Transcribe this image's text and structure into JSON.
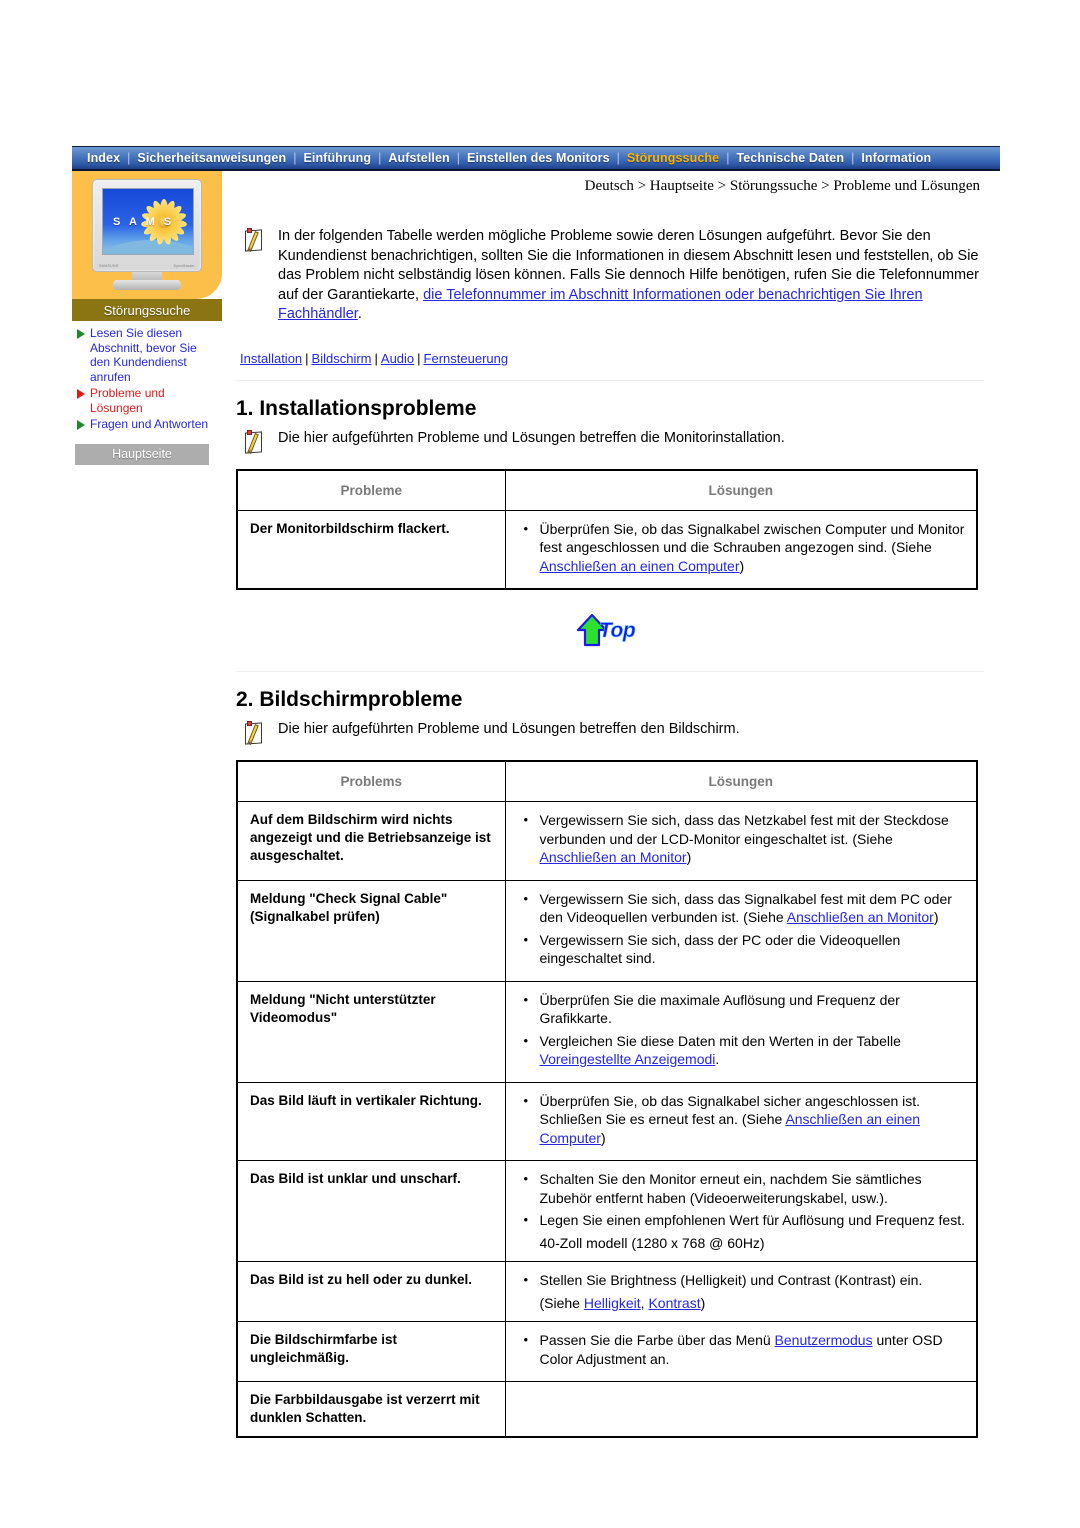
{
  "topnav": {
    "items": [
      {
        "label": "Index",
        "active": false
      },
      {
        "label": "Sicherheitsanweisungen",
        "active": false
      },
      {
        "label": "Einführung",
        "active": false
      },
      {
        "label": "Aufstellen",
        "active": false
      },
      {
        "label": "Einstellen des Monitors",
        "active": false
      },
      {
        "label": "Störungssuche",
        "active": true
      },
      {
        "label": "Technische Daten",
        "active": false
      },
      {
        "label": "Information",
        "active": false
      }
    ],
    "separator": "|",
    "active_color": "#ffb400",
    "text_color": "#ffffff"
  },
  "sidebar": {
    "monitor_screen_text": "S A M S",
    "monitor_brand": "SAMSUNG",
    "monitor_model": "SyncMaster",
    "section_title": "Störungssuche",
    "items": [
      {
        "label": "Lesen Sie diesen Abschnitt, bevor Sie den Kundendienst anrufen",
        "active": false
      },
      {
        "label": "Probleme und Lösungen",
        "active": true
      },
      {
        "label": "Fragen und Antworten",
        "active": false
      }
    ],
    "home_button": "Hauptseite",
    "active_color": "#e01b1b",
    "link_color": "#2727e0",
    "panel_color": "#fbbf4a",
    "title_bar_color": "#8a7512"
  },
  "main": {
    "breadcrumb": "Deutsch > Hauptseite > Störungssuche > Probleme und Lösungen",
    "intro": {
      "text_1": "In der folgenden Tabelle werden mögliche Probleme sowie deren Lösungen aufgeführt. Bevor Sie den Kundendienst benachrichtigen, sollten Sie die Informationen in diesem Abschnitt lesen und feststellen, ob Sie das Problem nicht selbständig lösen können. Falls Sie dennoch Hilfe benötigen, rufen Sie die Telefonnummer auf der Garantiekarte, ",
      "link_1": "die Telefonnummer im Abschnitt Informationen oder benachrichtigen Sie Ihren Fachhändler",
      "text_2": "."
    },
    "sublinks": [
      {
        "label": "Installation"
      },
      {
        "label": "Bildschirm"
      },
      {
        "label": "Audio"
      },
      {
        "label": "Fernsteuerung"
      }
    ],
    "sublink_separator": "|",
    "section1": {
      "heading": "1. Installationsprobleme",
      "note": "Die hier aufgeführten Probleme und Lösungen betreffen die Monitorinstallation.",
      "table": {
        "headers": [
          "Probleme",
          "Lösungen"
        ],
        "rows": [
          {
            "problem": "Der Monitorbildschirm flackert.",
            "solutions": [
              {
                "pre": "Überprüfen Sie, ob das Signalkabel zwischen Computer und Monitor fest angeschlossen und die Schrauben angezogen sind. (Siehe ",
                "link": "Anschließen an einen Computer",
                "post": ")"
              }
            ]
          }
        ]
      }
    },
    "top_button": {
      "label": "Top"
    },
    "section2": {
      "heading": "2. Bildschirmprobleme",
      "note": "Die hier aufgeführten Probleme und Lösungen betreffen den Bildschirm.",
      "table": {
        "headers": [
          "Problems",
          "Lösungen"
        ],
        "rows": [
          {
            "problem": "Auf dem Bildschirm wird nichts angezeigt und die Betriebsanzeige ist ausgeschaltet.",
            "solutions": [
              {
                "pre": "Vergewissern Sie sich, dass das Netzkabel fest mit der Steckdose verbunden und der LCD-Monitor eingeschaltet ist. (Siehe ",
                "link": "Anschließen an Monitor",
                "post": ")"
              }
            ]
          },
          {
            "problem": "Meldung \"Check Signal Cable\" (Signalkabel prüfen)",
            "solutions": [
              {
                "pre": "Vergewissern Sie sich, dass das Signalkabel fest mit dem PC oder den Videoquellen verbunden ist. (Siehe ",
                "link": "Anschließen an Monitor",
                "post": ")"
              },
              {
                "pre": "Vergewissern Sie sich, dass der PC oder die Videoquellen eingeschaltet sind.",
                "link": "",
                "post": ""
              }
            ]
          },
          {
            "problem": "Meldung \"Nicht unterstützter Videomodus\"",
            "solutions": [
              {
                "pre": "Überprüfen Sie die maximale Auflösung und Frequenz der Grafikkarte.",
                "link": "",
                "post": ""
              },
              {
                "pre": "Vergleichen Sie diese Daten mit den Werten in der Tabelle ",
                "link": "Voreingestellte Anzeigemodi",
                "post": "."
              }
            ]
          },
          {
            "problem": "Das Bild läuft in vertikaler Richtung.",
            "solutions": [
              {
                "pre": "Überprüfen Sie, ob das Signalkabel sicher angeschlossen ist. Schließen Sie es erneut fest an. (Siehe ",
                "link": "Anschließen an einen Computer",
                "post": ")"
              }
            ]
          },
          {
            "problem": "Das Bild ist unklar und unscharf.",
            "solutions": [
              {
                "pre": "Schalten Sie den Monitor erneut ein, nachdem Sie sämtliches Zubehör entfernt haben (Videoerweiterungskabel, usw.).",
                "link": "",
                "post": ""
              },
              {
                "pre": "Legen Sie einen empfohlenen Wert für Auflösung und Frequenz fest.",
                "link": "",
                "post": ""
              }
            ],
            "extra_line": "40-Zoll modell (1280 x 768 @ 60Hz)"
          },
          {
            "problem": "Das Bild ist zu hell oder zu dunkel.",
            "solutions": [
              {
                "pre": "Stellen Sie Brightness (Helligkeit) und Contrast (Kontrast) ein.",
                "link": "",
                "post": ""
              }
            ],
            "extra_siehe": {
              "pre": "(Siehe ",
              "link1": "Helligkeit",
              "mid": ", ",
              "link2": "Kontrast",
              "post": ")"
            }
          },
          {
            "problem": "Die Bildschirmfarbe ist ungleichmäßig.",
            "solutions": [
              {
                "pre": "Passen Sie die Farbe über das Menü ",
                "link": "Benutzermodus",
                "post": " unter OSD Color Adjustment an."
              }
            ]
          },
          {
            "problem": "Die Farbbildausgabe ist verzerrt mit dunklen Schatten.",
            "solutions": []
          }
        ]
      }
    }
  }
}
